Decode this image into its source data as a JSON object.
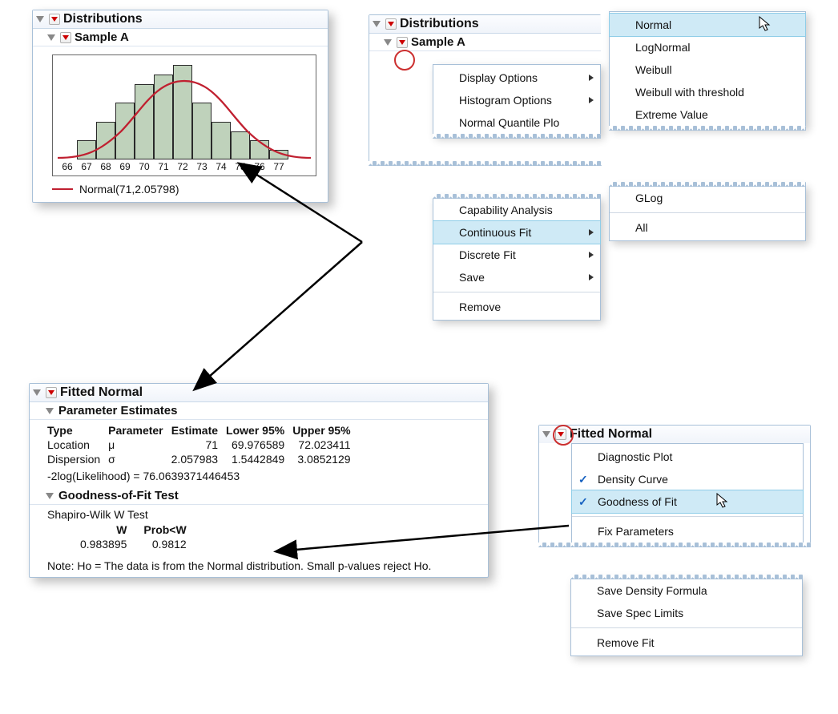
{
  "panel_left": {
    "title": "Distributions",
    "sample_title": "Sample A",
    "legend_label": "Normal(71,2.05798)"
  },
  "chart_data": {
    "type": "bar",
    "categories": [
      "66",
      "67",
      "68",
      "69",
      "70",
      "71",
      "72",
      "73",
      "74",
      "75",
      "76",
      "77"
    ],
    "values": [
      0,
      1,
      2,
      3,
      4,
      4.5,
      5,
      3,
      2,
      1.5,
      1,
      0.5
    ],
    "curve_params": {
      "mu": 71,
      "sigma": 2.05798
    },
    "xlabel": "",
    "ylabel": "",
    "title": ""
  },
  "panel_right_top": {
    "title": "Distributions",
    "sample_title": "Sample A"
  },
  "sample_menu": {
    "display_options": "Display Options",
    "hist_options": "Histogram Options",
    "nq_plot": "Normal Quantile Plo",
    "cap_analysis": "Capability Analysis",
    "cont_fit": "Continuous Fit",
    "discrete_fit": "Discrete Fit",
    "save": "Save",
    "remove": "Remove"
  },
  "dist_submenu": {
    "normal": "Normal",
    "lognormal": "LogNormal",
    "weibull": "Weibull",
    "weibull_thr": "Weibull with threshold",
    "extreme": "Extreme Value",
    "glog": "GLog",
    "all": "All"
  },
  "fitted_panel": {
    "title": "Fitted Normal",
    "pest_title": "Parameter Estimates",
    "columns": {
      "type": "Type",
      "parameter": "Parameter",
      "estimate": "Estimate",
      "lower": "Lower 95%",
      "upper": "Upper 95%"
    },
    "rows": [
      {
        "type": "Location",
        "parameter": "μ",
        "estimate": "71",
        "lower": "69.976589",
        "upper": "72.023411"
      },
      {
        "type": "Dispersion",
        "parameter": "σ",
        "estimate": "2.057983",
        "lower": "1.5442849",
        "upper": "3.0852129"
      }
    ],
    "loglik": "-2log(Likelihood) = 76.0639371446453",
    "gof_title": "Goodness-of-Fit Test",
    "gof_name": "Shapiro-Wilk W Test",
    "gof_cols": {
      "w": "W",
      "probw": "Prob<W"
    },
    "gof_vals": {
      "w": "0.983895",
      "probw": "0.9812"
    },
    "note": "Note: Ho = The data is from the Normal distribution. Small p-values reject Ho."
  },
  "fitted_menu": {
    "title": "Fitted Normal",
    "diag": "Diagnostic Plot",
    "density": "Density Curve",
    "gof": "Goodness of Fit",
    "fixparams": "Fix Parameters",
    "save_density": "Save Density Formula",
    "save_spec": "Save Spec Limits",
    "remove_fit": "Remove Fit"
  }
}
